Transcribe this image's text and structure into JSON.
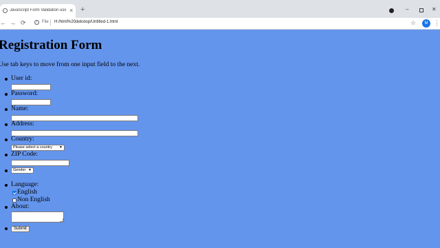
{
  "browser": {
    "tab": {
      "title": "JavaScript Form Validation using",
      "close_glyph": "×"
    },
    "new_tab_glyph": "+",
    "window_controls": {
      "minimize": "–",
      "close": "✕"
    },
    "nav": {
      "back": "←",
      "forward": "→",
      "reload": "⟳"
    },
    "address_bar": {
      "scheme_label": "File",
      "url": "H:/html%20dekstop/Untitled-1.html"
    },
    "bookmark_glyph": "☆",
    "avatar_letter": "M",
    "menu_glyph": "⋮",
    "accent_color": "#1a73e8"
  },
  "page": {
    "background_color": "#6495ed",
    "title": "Registration Form",
    "instructions": "Use tab keys to move from one input field to the next.",
    "form": {
      "user_id": {
        "label": "User id:",
        "value": ""
      },
      "password": {
        "label": "Password:",
        "value": ""
      },
      "name": {
        "label": "Name:",
        "value": ""
      },
      "address": {
        "label": "Address:",
        "value": ""
      },
      "country": {
        "label": "Country:",
        "selected": "Please select a country"
      },
      "zip": {
        "label": "ZIP Code:",
        "value": ""
      },
      "gender": {
        "selected": "Gender"
      },
      "language": {
        "label": "Language:",
        "options": [
          {
            "label": "English",
            "checked": true
          },
          {
            "label": "Non English",
            "checked": false
          }
        ]
      },
      "about": {
        "label": "About:",
        "value": ""
      },
      "submit_label": "Submit"
    }
  }
}
